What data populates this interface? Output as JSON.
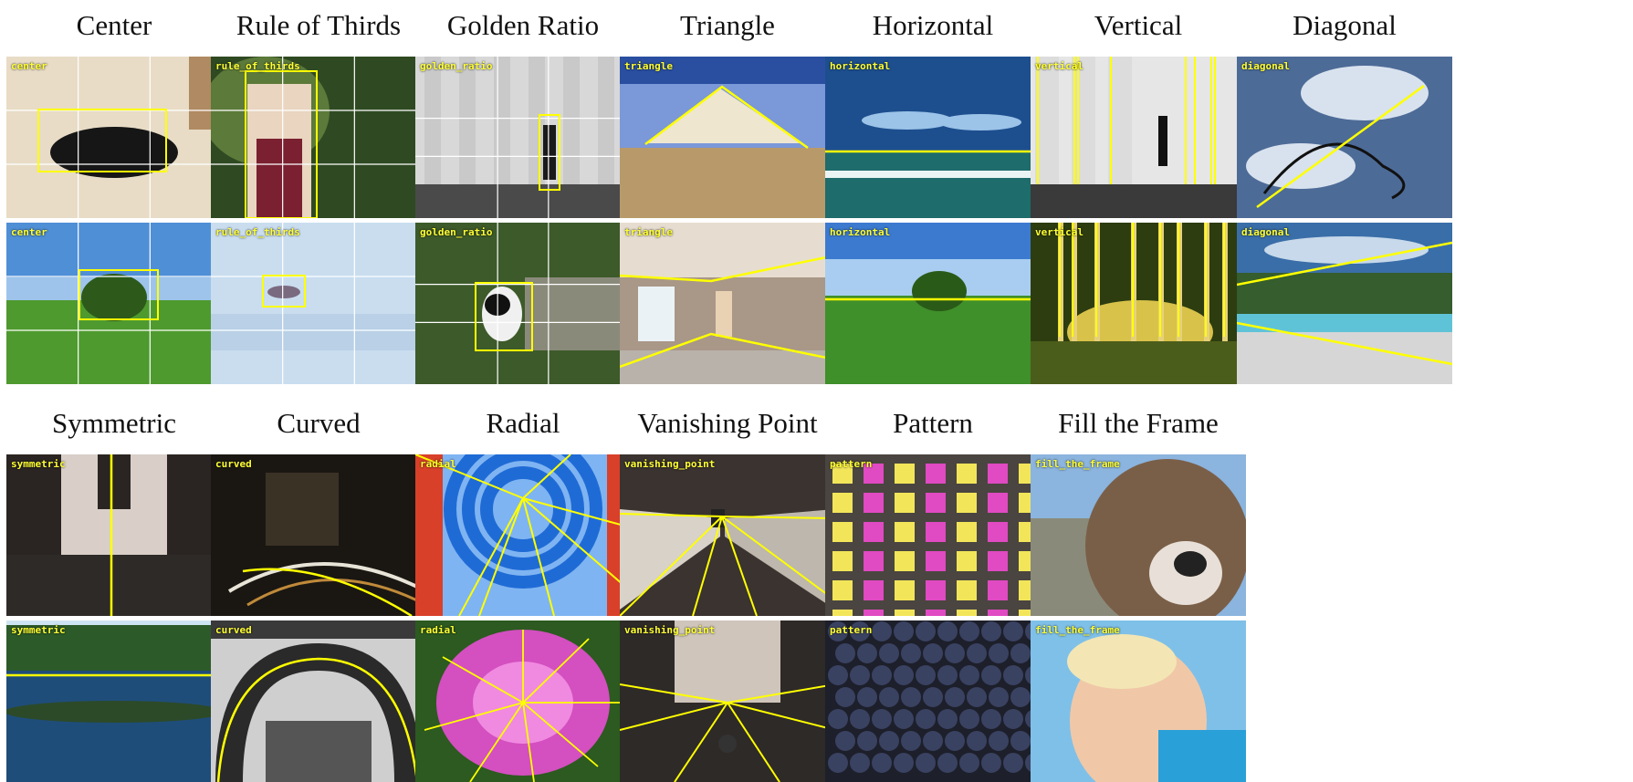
{
  "colors": {
    "overlay": "#ffff00",
    "grid": "#ffffff",
    "tag_text": "#ffff33"
  },
  "row_groups": [
    {
      "columns": [
        {
          "key": "center",
          "title": "Center",
          "images": [
            {
              "tag": "center",
              "icon": "cat-on-rug-photo"
            },
            {
              "tag": "center",
              "icon": "lone-tree-field-photo"
            }
          ]
        },
        {
          "key": "rule_of_thirds",
          "title": "Rule of Thirds",
          "images": [
            {
              "tag": "rule_of_thirds",
              "icon": "woman-in-garden-photo"
            },
            {
              "tag": "rule_of_thirds",
              "icon": "airplane-in-sky-photo"
            }
          ]
        },
        {
          "key": "golden_ratio",
          "title": "Golden Ratio",
          "images": [
            {
              "tag": "golden_ratio",
              "icon": "colonnade-walker-photo"
            },
            {
              "tag": "golden_ratio",
              "icon": "panda-photo"
            }
          ]
        },
        {
          "key": "triangle",
          "title": "Triangle",
          "images": [
            {
              "tag": "triangle",
              "icon": "gabled-building-photo"
            },
            {
              "tag": "triangle",
              "icon": "empty-room-photo"
            }
          ]
        },
        {
          "key": "horizontal",
          "title": "Horizontal",
          "images": [
            {
              "tag": "horizontal",
              "icon": "sea-horizon-photo"
            },
            {
              "tag": "horizontal",
              "icon": "tree-on-horizon-photo"
            }
          ]
        },
        {
          "key": "vertical",
          "title": "Vertical",
          "images": [
            {
              "tag": "vertical",
              "icon": "columns-street-photo"
            },
            {
              "tag": "vertical",
              "icon": "forest-sunlight-photo"
            }
          ]
        },
        {
          "key": "diagonal",
          "title": "Diagonal",
          "images": [
            {
              "tag": "diagonal",
              "icon": "bird-sculpture-sky-photo"
            },
            {
              "tag": "diagonal",
              "icon": "mountain-river-photo"
            }
          ]
        }
      ]
    },
    {
      "columns": [
        {
          "key": "symmetric",
          "title": "Symmetric",
          "images": [
            {
              "tag": "symmetric",
              "icon": "bridge-walkway-photo"
            },
            {
              "tag": "symmetric",
              "icon": "lake-reflection-photo"
            }
          ]
        },
        {
          "key": "curved",
          "title": "Curved",
          "images": [
            {
              "tag": "curved",
              "icon": "night-traffic-trails-photo"
            },
            {
              "tag": "curved",
              "icon": "arched-doorway-photo"
            }
          ]
        },
        {
          "key": "radial",
          "title": "Radial",
          "images": [
            {
              "tag": "radial",
              "icon": "blue-metal-spiral-photo"
            },
            {
              "tag": "radial",
              "icon": "pink-dahlia-photo"
            }
          ]
        },
        {
          "key": "vanishing_point",
          "title": "Vanishing Point",
          "images": [
            {
              "tag": "vanishing_point",
              "icon": "tunnel-cyclist-photo"
            },
            {
              "tag": "vanishing_point",
              "icon": "bridge-perspective-photo"
            }
          ]
        },
        {
          "key": "pattern",
          "title": "Pattern",
          "images": [
            {
              "tag": "pattern",
              "icon": "love-locks-fence-photo"
            },
            {
              "tag": "pattern",
              "icon": "blueberries-photo"
            }
          ]
        },
        {
          "key": "fill_the_frame",
          "title": "Fill the Frame",
          "images": [
            {
              "tag": "fill_the_frame",
              "icon": "dog-face-photo"
            },
            {
              "tag": "fill_the_frame",
              "icon": "smiling-baby-photo"
            }
          ]
        }
      ]
    }
  ]
}
